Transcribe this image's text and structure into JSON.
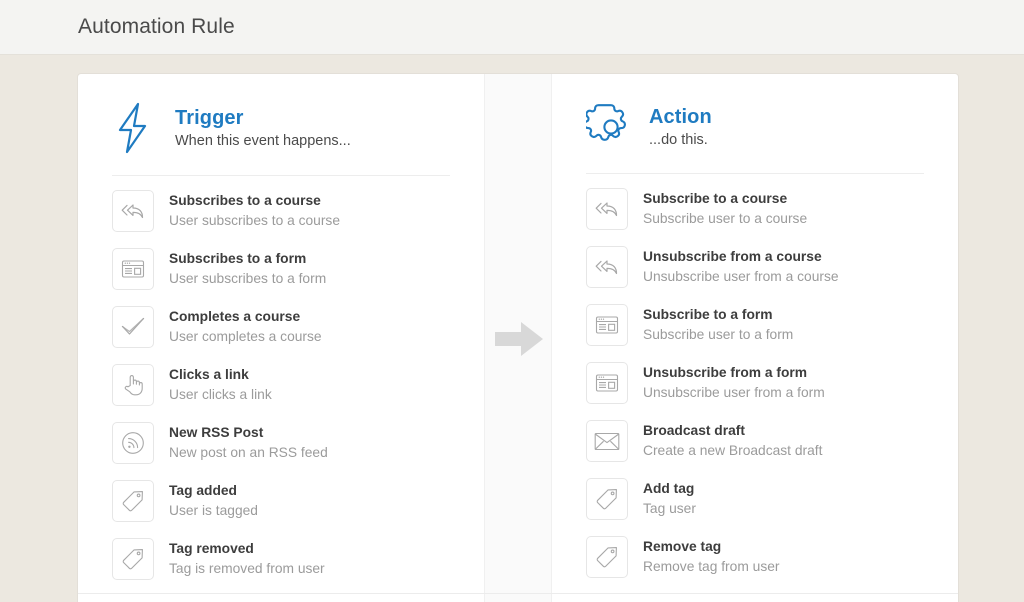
{
  "header": {
    "title": "Automation Rule"
  },
  "gutter": {
    "arrow_icon": "arrow-right-icon",
    "arrow_color": "#d8d8d8"
  },
  "colors": {
    "accent": "#1f7bc1",
    "page_background": "#ece8e0",
    "card_background": "#ffffff",
    "title_text": "#3d3d3d",
    "desc_text": "#9b9b9b"
  },
  "trigger": {
    "icon": "lightning-bolt-icon",
    "title": "Trigger",
    "subtitle": "When this event happens...",
    "items": [
      {
        "icon": "subscribe-arrow-icon",
        "title": "Subscribes to a course",
        "desc": "User subscribes to a course"
      },
      {
        "icon": "form-window-icon",
        "title": "Subscribes to a form",
        "desc": "User subscribes to a form"
      },
      {
        "icon": "checkmark-icon",
        "title": "Completes a course",
        "desc": "User completes a course"
      },
      {
        "icon": "pointing-hand-icon",
        "title": "Clicks a link",
        "desc": "User clicks a link"
      },
      {
        "icon": "rss-icon",
        "title": "New RSS Post",
        "desc": "New post on an RSS feed"
      },
      {
        "icon": "tag-icon",
        "title": "Tag added",
        "desc": "User is tagged"
      },
      {
        "icon": "tag-icon",
        "title": "Tag removed",
        "desc": "Tag is removed from user"
      }
    ]
  },
  "action": {
    "icon": "gear-icon",
    "title": "Action",
    "subtitle": "...do this.",
    "items": [
      {
        "icon": "subscribe-arrow-icon",
        "title": "Subscribe to a course",
        "desc": "Subscribe user to a course"
      },
      {
        "icon": "subscribe-arrow-icon",
        "title": "Unsubscribe from a course",
        "desc": "Unsubscribe user from a course"
      },
      {
        "icon": "form-window-icon",
        "title": "Subscribe to a form",
        "desc": "Subscribe user to a form"
      },
      {
        "icon": "form-window-icon",
        "title": "Unsubscribe from a form",
        "desc": "Unsubscribe user from a form"
      },
      {
        "icon": "envelope-icon",
        "title": "Broadcast draft",
        "desc": "Create a new Broadcast draft"
      },
      {
        "icon": "tag-icon",
        "title": "Add tag",
        "desc": "Tag user"
      },
      {
        "icon": "tag-icon",
        "title": "Remove tag",
        "desc": "Remove tag from user"
      }
    ]
  }
}
